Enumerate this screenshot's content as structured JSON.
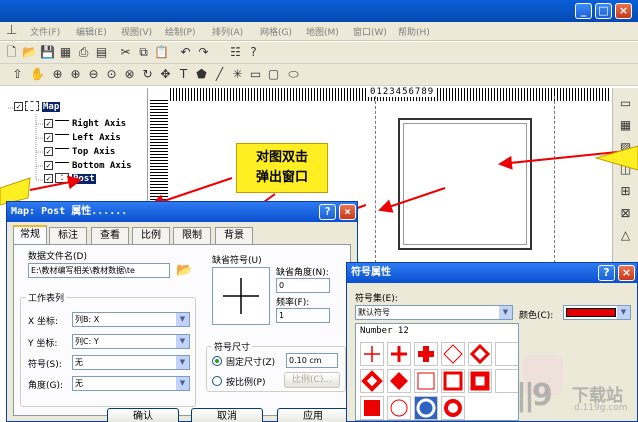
{
  "menubar": {
    "items": [
      "文件(F)",
      "编辑(E)",
      "视图(V)",
      "绘制(P)",
      "排列(A)",
      "网格(G)",
      "地图(M)",
      "窗口(W)",
      "帮助(H)"
    ]
  },
  "tree": {
    "root": "Map",
    "items": [
      "Right Axis",
      "Left Axis",
      "Top Axis",
      "Bottom Axis",
      "Post"
    ]
  },
  "ruler": {
    "label": "0123456789"
  },
  "callout": {
    "line1": "对图双击",
    "line2": "弹出窗口"
  },
  "map_dialog": {
    "title": "Map: Post 属性......",
    "tabs": [
      "常规",
      "标注",
      "查看",
      "比例",
      "限制",
      "背景"
    ],
    "data_file_label": "数据文件名(D)",
    "data_file_value": "E:\\教材编写相关\\教材数据\\te",
    "worksheet_group": "工作表列",
    "x_label": "X 坐标:",
    "x_value": "列B:  X",
    "y_label": "Y 坐标:",
    "y_value": "列C:  Y",
    "symbol_label": "符号(S):",
    "symbol_value": "无",
    "angle_label": "角度(G):",
    "angle_value": "无",
    "default_symbol_label": "缺省符号(U)",
    "default_angle_label": "缺省角度(N):",
    "default_angle_value": "0",
    "frequency_label": "频率(F):",
    "frequency_value": "1",
    "symbol_size_group": "符号尺寸",
    "fixed_size_label": "固定尺寸(Z)",
    "fixed_size_value": "0.10 cm",
    "by_scale_label": "按比例(P)",
    "scale_button": "比例(C)...",
    "ok_button": "确认",
    "cancel_button": "取消",
    "apply_button": "应用"
  },
  "sym_dialog": {
    "title": "符号属性",
    "set_label": "符号集(E):",
    "set_value": "默认符号",
    "color_label": "颜色(C):",
    "color_value": "#e00000",
    "number_label": "Number 12"
  },
  "watermark": {
    "brand": "下载站",
    "url": "d.119g.com"
  }
}
